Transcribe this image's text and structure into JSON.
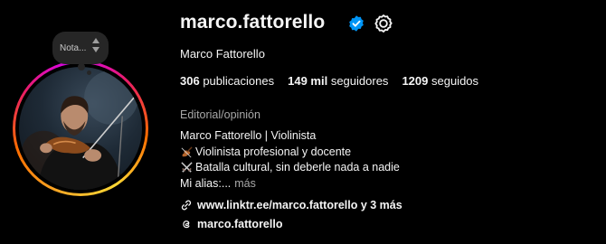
{
  "note": {
    "label": "Nota..."
  },
  "profile": {
    "username": "marco.fattorello",
    "full_name": "Marco Fattorello",
    "verified": true,
    "accent_color": "#0095f6"
  },
  "stats": {
    "posts_count": "306",
    "posts_label": "publicaciones",
    "followers_count": "149 mil",
    "followers_label": "seguidores",
    "following_count": "1209",
    "following_label": "seguidos"
  },
  "category": "Editorial/opinión",
  "bio": {
    "line1": "Marco Fattorello | Violinista",
    "line2": "Violinista profesional y docente",
    "line3": "Batalla cultural, sin deberle nada a nadie",
    "line4": "Mi alias:...",
    "more_label": "más",
    "line2_icon": "violin-icon",
    "line3_icon": "crossed-swords-icon"
  },
  "links": {
    "website": "www.linktr.ee/marco.fattorello y 3 más",
    "threads": "marco.fattorello"
  }
}
